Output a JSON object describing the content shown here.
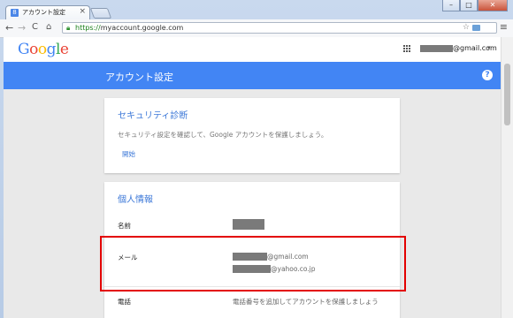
{
  "browser": {
    "tab_title": "アカウント設定",
    "tab_close": "×",
    "favicon_letter": "8",
    "window_controls": [
      "–",
      "□",
      "✕"
    ],
    "url_prefix": "https://",
    "url_host": "myaccount.google.com",
    "menu_icon": "≡",
    "back_icon": "←",
    "forward_icon": "→",
    "reload_icon": "C",
    "home_icon": "⌂",
    "star_icon": "☆"
  },
  "header": {
    "logo": [
      "G",
      "o",
      "o",
      "g",
      "l",
      "e"
    ],
    "account_suffix": "@gmail.com",
    "account_caret": "▾"
  },
  "banner": {
    "title": "アカウント設定",
    "help": "?"
  },
  "security": {
    "title": "セキュリティ診断",
    "description": "セキュリティ設定を確認して、Google アカウントを保護しましょう。",
    "start_link": "開始"
  },
  "personal": {
    "title": "個人情報",
    "name_label": "名前",
    "email_label": "メール",
    "email_1_suffix": "@gmail.com",
    "email_2_suffix": "@yahoo.co.jp",
    "phone_label": "電話",
    "phone_value": "電話番号を追加してアカウントを保護しましょう"
  },
  "colors": {
    "accent": "#4285f4",
    "link": "#3c78d8",
    "highlight": "#e30000",
    "redaction": "#7a7a7a"
  }
}
